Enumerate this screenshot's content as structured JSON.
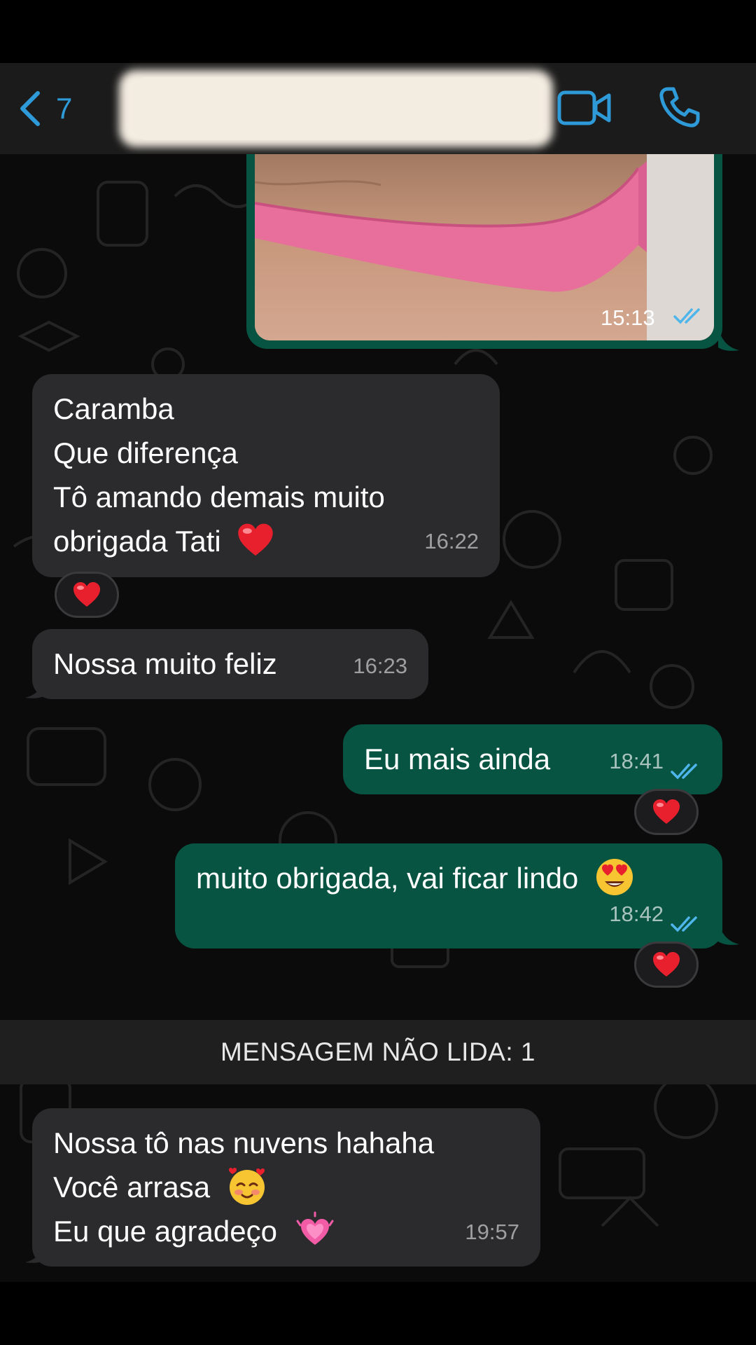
{
  "header": {
    "back_count": "7"
  },
  "messages": {
    "image": {
      "time": "15:13"
    },
    "m1": {
      "lines": [
        "Caramba",
        "Que diferença",
        "Tô amando demais muito",
        "obrigada Tati"
      ],
      "time": "16:22"
    },
    "m2": {
      "text": "Nossa muito feliz",
      "time": "16:23"
    },
    "m3": {
      "text": "Eu mais ainda",
      "time": "18:41"
    },
    "m4": {
      "text": "muito obrigada, vai ficar lindo",
      "time": "18:42"
    },
    "m5": {
      "lines": [
        "Nossa tô nas nuvens hahaha",
        "Você arrasa",
        "Eu que agradeço"
      ],
      "time": "19:57"
    }
  },
  "unread": {
    "label": "MENSAGEM NÃO LIDA: 1"
  },
  "colors": {
    "accent": "#2e9ad8",
    "incoming_bubble": "#2b2b2d",
    "outgoing_bubble": "#085442",
    "read_ticks": "#4fb6ec"
  },
  "icons": [
    "chevron-left-icon",
    "video-camera-icon",
    "phone-icon",
    "double-check-icon",
    "red-heart-icon",
    "heart-eyes-emoji",
    "smiling-hearts-emoji",
    "growing-heart-emoji"
  ]
}
